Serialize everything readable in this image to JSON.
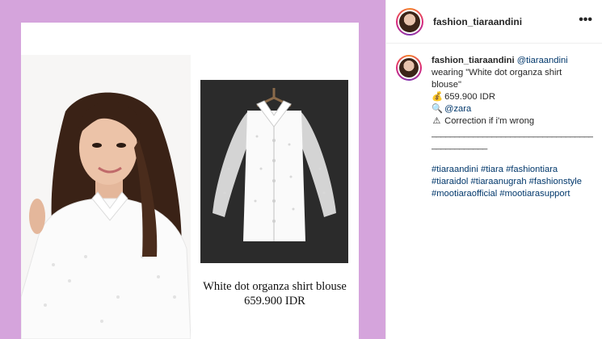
{
  "post": {
    "caption_title": "White dot organza shirt blouse",
    "caption_price": "659.900 IDR"
  },
  "header": {
    "username": "fashion_tiaraandini",
    "more_label": "•••"
  },
  "comment": {
    "username": "fashion_tiaraandini",
    "mention": "@tiaraandini",
    "line1": "wearing \"White dot organza shirt blouse\"",
    "price_icon": "money-bag-icon",
    "price": "659.900 IDR",
    "brand_icon": "magnifier-icon",
    "brand": "@zara",
    "note_icon": "warning-icon",
    "note": "Correction if i'm wrong",
    "divider1": "_______________________________________",
    "divider2": "____________",
    "hashtags": [
      "#tiaraandini",
      "#tiara",
      "#fashiontiara",
      "#tiaraidol",
      "#tiaraanugrah",
      "#fashionstyle",
      "#mootiaraofficial",
      "#mootiarasupport"
    ]
  },
  "colors": {
    "post_background": "#d5a4dc",
    "link": "#00376b",
    "text": "#262626"
  }
}
